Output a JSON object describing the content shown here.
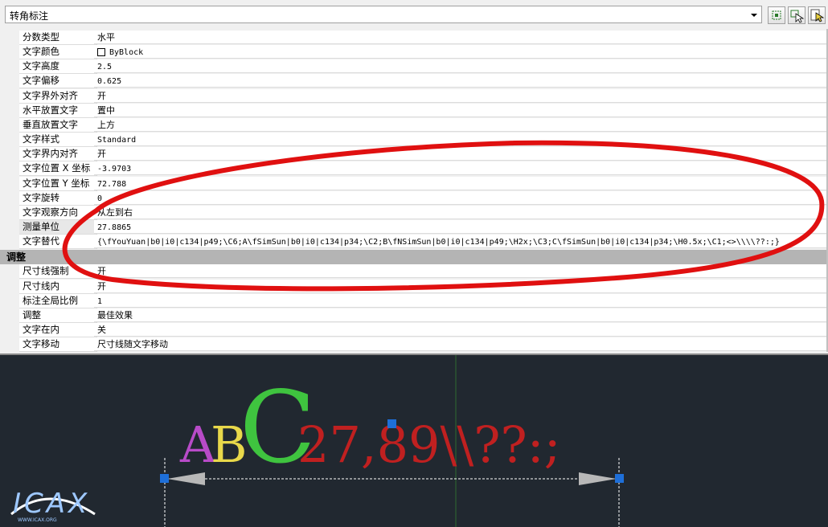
{
  "combo": {
    "value": "转角标注"
  },
  "toolbar": {
    "icons": [
      "quick-select-icon",
      "select-objects-icon",
      "toggle-pickadd-icon"
    ]
  },
  "properties": [
    {
      "name": "分数类型",
      "value": "水平"
    },
    {
      "name": "文字颜色",
      "value": "ByBlock",
      "swatch": "#ffffff"
    },
    {
      "name": "文字高度",
      "value": "2.5"
    },
    {
      "name": "文字偏移",
      "value": "0.625"
    },
    {
      "name": "文字界外对齐",
      "value": "开"
    },
    {
      "name": "水平放置文字",
      "value": "置中"
    },
    {
      "name": "垂直放置文字",
      "value": "上方"
    },
    {
      "name": "文字样式",
      "value": "Standard"
    },
    {
      "name": "文字界内对齐",
      "value": "开"
    },
    {
      "name": "文字位置 X 坐标",
      "value": "-3.9703"
    },
    {
      "name": "文字位置 Y 坐标",
      "value": "72.788"
    },
    {
      "name": "文字旋转",
      "value": "0"
    },
    {
      "name": "文字观察方向",
      "value": "从左到右"
    },
    {
      "name": "测量单位",
      "value": "27.8865"
    },
    {
      "name": "文字替代",
      "value": "{\\fYouYuan|b0|i0|c134|p49;\\C6;A\\fSimSun|b0|i0|c134|p34;\\C2;B\\fNSimSun|b0|i0|c134|p49;\\H2x;\\C3;C\\fSimSun|b0|i0|c134|p34;\\H0.5x;\\C1;<>\\\\\\\\??:;}"
    }
  ],
  "section_title": "调整",
  "adjust_properties": [
    {
      "name": "尺寸线强制",
      "value": "开"
    },
    {
      "name": "尺寸线内",
      "value": "开"
    },
    {
      "name": "标注全局比例",
      "value": "1"
    },
    {
      "name": "调整",
      "value": "最佳效果"
    },
    {
      "name": "文字在内",
      "value": "关"
    },
    {
      "name": "文字移动",
      "value": "尺寸线随文字移动"
    }
  ],
  "cad": {
    "text_a": "A",
    "text_b": "B",
    "text_c": "C",
    "text_rest": "27,89\\\\??:;",
    "logo_text": "ICAX",
    "logo_url": "WWW.ICAX.ORG",
    "colors": {
      "a": "#b84bc8",
      "b": "#e8d84a",
      "c": "#3fc43f",
      "rest": "#c02020",
      "grip": "#1e6fd9",
      "line": "#ffffff",
      "bg": "#212830"
    }
  },
  "annotation_color": "#e01010"
}
